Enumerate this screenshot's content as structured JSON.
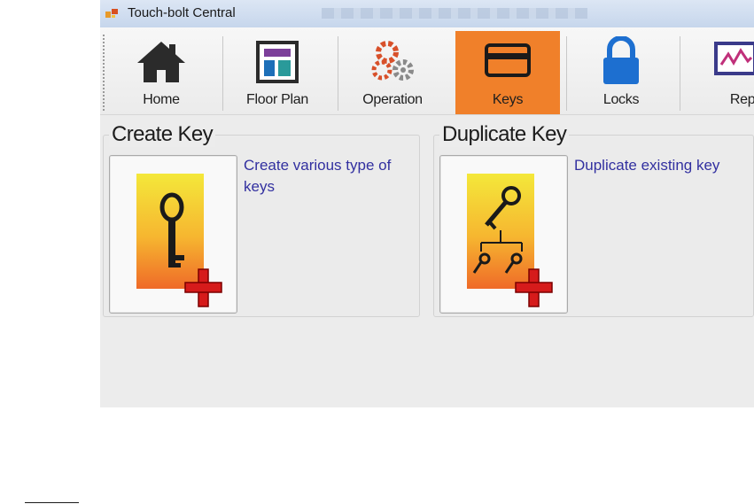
{
  "window": {
    "title": "Touch-bolt Central"
  },
  "toolbar": {
    "items": [
      {
        "label": "Home",
        "icon": "home-icon"
      },
      {
        "label": "Floor Plan",
        "icon": "floor-plan-icon"
      },
      {
        "label": "Operation",
        "icon": "gears-icon"
      },
      {
        "label": "Keys",
        "icon": "key-card-icon",
        "active": true
      },
      {
        "label": "Locks",
        "icon": "padlock-icon"
      },
      {
        "label": "Report",
        "icon": "report-chart-icon"
      }
    ],
    "active_color": "#f0802a"
  },
  "panels": {
    "create_key": {
      "title": "Create Key",
      "description": "Create various type of keys",
      "icon": "create-key-icon"
    },
    "duplicate_key": {
      "title": "Duplicate Key",
      "description": "Duplicate existing key",
      "icon": "duplicate-key-icon"
    }
  }
}
